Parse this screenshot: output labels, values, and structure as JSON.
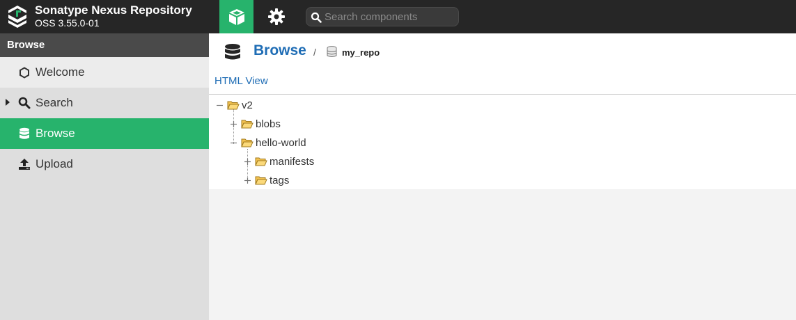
{
  "header": {
    "app_title": "Sonatype Nexus Repository",
    "version": "OSS 3.55.0-01",
    "search_placeholder": "Search components"
  },
  "sidebar": {
    "title": "Browse",
    "items": [
      {
        "label": "Welcome",
        "icon": "hexagon-icon"
      },
      {
        "label": "Search",
        "icon": "search-icon"
      },
      {
        "label": "Browse",
        "icon": "database-icon",
        "active": true
      },
      {
        "label": "Upload",
        "icon": "upload-icon"
      }
    ]
  },
  "breadcrumb": {
    "title": "Browse",
    "separator": "/",
    "repo": "my_repo"
  },
  "view_link": "HTML View",
  "tree": [
    {
      "label": "v2",
      "level": 0,
      "expanded": true
    },
    {
      "label": "blobs",
      "level": 1,
      "expanded": false
    },
    {
      "label": "hello-world",
      "level": 1,
      "expanded": true
    },
    {
      "label": "manifests",
      "level": 2,
      "expanded": false
    },
    {
      "label": "tags",
      "level": 2,
      "expanded": false
    }
  ],
  "colors": {
    "accent": "#27b36c",
    "link": "#1f6db5",
    "topbar": "#262626",
    "folder": "#f3c250"
  }
}
